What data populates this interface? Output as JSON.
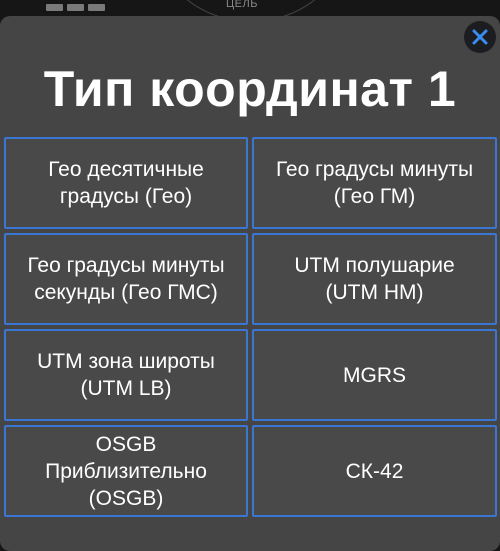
{
  "background": {
    "label": "ЦЕЛЬ"
  },
  "dialog": {
    "title": "Тип координат 1",
    "close_icon": "close-icon",
    "options": [
      {
        "label": "Гео десятичные\nградусы (Гео)"
      },
      {
        "label": "Гео градусы минуты\n(Гео ГМ)"
      },
      {
        "label": "Гео градусы минуты\nсекунды (Гео ГМС)"
      },
      {
        "label": "UTM полушарие\n(UTM HM)"
      },
      {
        "label": "UTM зона широты\n(UTM LB)"
      },
      {
        "label": "MGRS"
      },
      {
        "label": "OSGB\nПриблизительно\n(OSGB)"
      },
      {
        "label": "СК-42"
      }
    ]
  },
  "colors": {
    "accent": "#3b76d3",
    "modal_bg": "#454545",
    "button_bg": "#494949",
    "close_bg": "#1b1d21"
  }
}
